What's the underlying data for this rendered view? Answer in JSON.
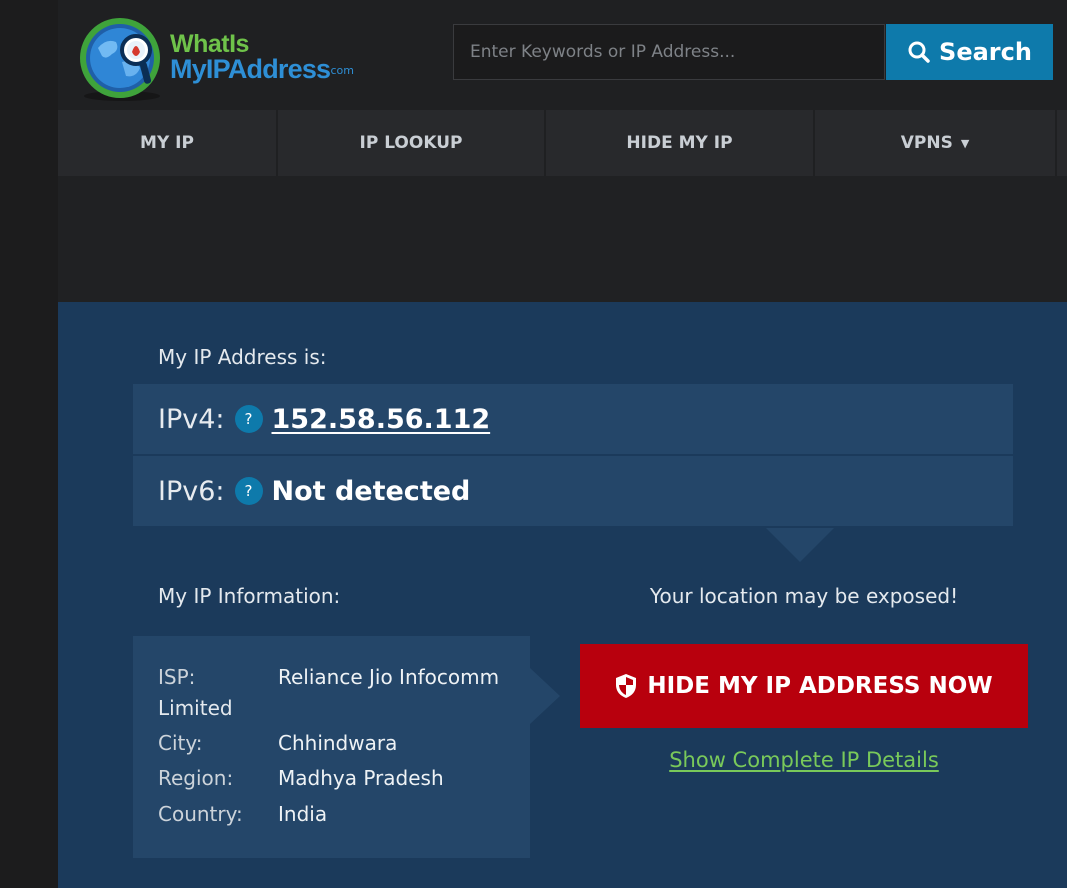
{
  "logo": {
    "line1": "WhatIs",
    "line2": "MyIPAddress",
    "suffix": ".com",
    "icon": "globe-magnifier-icon",
    "colors": {
      "green": "#6fc34a",
      "blue": "#2e8fd6"
    }
  },
  "search": {
    "placeholder": "Enter Keywords or IP Address...",
    "value": "",
    "button_label": "Search",
    "icon": "search-icon"
  },
  "nav": {
    "items": [
      {
        "label": "MY IP"
      },
      {
        "label": "IP LOOKUP"
      },
      {
        "label": "HIDE MY IP"
      },
      {
        "label": "VPNS",
        "caret": "▼"
      }
    ]
  },
  "main": {
    "ip_heading": "My IP Address is:",
    "ipv4": {
      "label": "IPv4:",
      "help": "?",
      "value": "152.58.56.112"
    },
    "ipv6": {
      "label": "IPv6:",
      "help": "?",
      "value": "Not detected"
    },
    "info_heading": "My IP Information:",
    "info": {
      "isp": {
        "key": "ISP:",
        "value_line1": "Reliance Jio Infocomm",
        "value_line2": "Limited"
      },
      "city": {
        "key": "City:",
        "value": "Chhindwara"
      },
      "region": {
        "key": "Region:",
        "value": "Madhya Pradesh"
      },
      "country": {
        "key": "Country:",
        "value": "India"
      }
    },
    "warning": "Your location may be exposed!",
    "hide_button": "HIDE MY IP ADDRESS NOW",
    "details_link": "Show Complete IP Details"
  },
  "colors": {
    "accent_blue": "#0e7aab",
    "panel": "#1b3a5b",
    "box": "#244669",
    "cta_red": "#b8000d",
    "link_green": "#79c95a"
  }
}
